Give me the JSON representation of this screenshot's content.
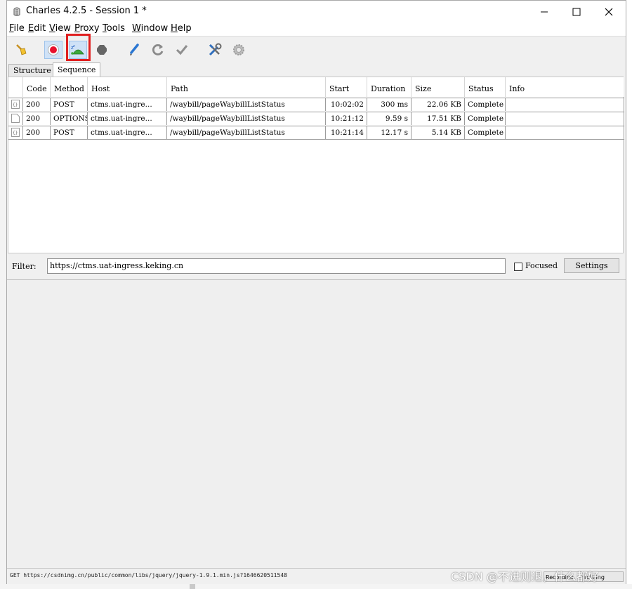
{
  "window": {
    "title": "Charles 4.2.5 - Session 1 *"
  },
  "menu": {
    "items": [
      {
        "key": "F",
        "rest": "ile"
      },
      {
        "key": "E",
        "rest": "dit"
      },
      {
        "key": "V",
        "rest": "iew"
      },
      {
        "key": "P",
        "rest": "roxy"
      },
      {
        "key": "T",
        "rest": "ools"
      },
      {
        "key": "W",
        "rest": "indow"
      },
      {
        "key": "H",
        "rest": "elp"
      }
    ]
  },
  "toolbar": {
    "buttons": [
      "broom-icon",
      "record-icon",
      "throttle-turtle-icon",
      "breakpoints-hexagon-icon",
      "compose-pen-icon",
      "repeat-icon",
      "validate-check-icon",
      "tools-icon",
      "settings-gear-icon"
    ],
    "highlighted": "throttle-turtle-icon",
    "highlight_color": "#e02020"
  },
  "tabs": {
    "structure": "Structure",
    "sequence": "Sequence",
    "selected": "Sequence"
  },
  "table": {
    "headers": [
      "Code",
      "Method",
      "Host",
      "Path",
      "Start",
      "Duration",
      "Size",
      "Status",
      "Info"
    ],
    "rows": [
      {
        "code": "200",
        "method": "POST",
        "host": "ctms.uat-ingre...",
        "path": "/waybill/pageWaybillListStatus",
        "start": "10:02:02",
        "duration": "300 ms",
        "size": "22.06 KB",
        "status": "Complete",
        "info": "",
        "icon": "json-file-icon"
      },
      {
        "code": "200",
        "method": "OPTIONS",
        "host": "ctms.uat-ingre...",
        "path": "/waybill/pageWaybillListStatus",
        "start": "10:21:12",
        "duration": "9.59 s",
        "size": "17.51 KB",
        "status": "Complete",
        "info": "",
        "icon": "blank-file-icon"
      },
      {
        "code": "200",
        "method": "POST",
        "host": "ctms.uat-ingre...",
        "path": "/waybill/pageWaybillListStatus",
        "start": "10:21:14",
        "duration": "12.17 s",
        "size": "5.14 KB",
        "status": "Complete",
        "info": "",
        "icon": "json-file-icon"
      }
    ]
  },
  "filter": {
    "label": "Filter:",
    "value": "https://ctms.uat-ingress.keking.cn",
    "focused_label": "Focused",
    "focused_checked": false,
    "settings_label": "Settings"
  },
  "statusbar": {
    "text": "GET https://csdnimg.cn/public/common/libs/jquery/jquery-1.9.1.min.js?1646620511548",
    "right": "Recording, Throttling"
  },
  "watermark": "CSDN @不进则退，什么都好"
}
